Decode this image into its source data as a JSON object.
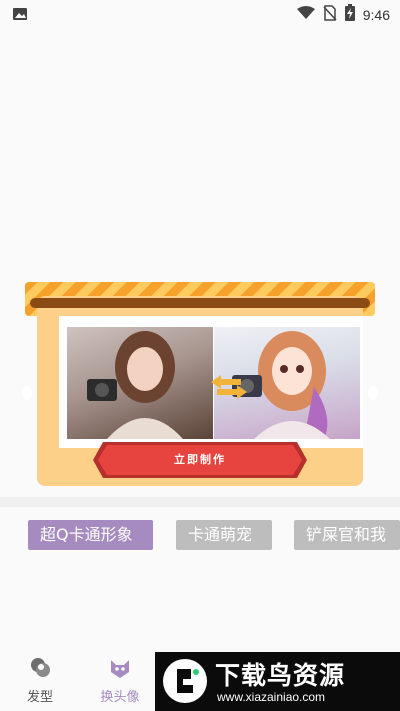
{
  "status_bar": {
    "time": "9:46",
    "icons": [
      "image-icon",
      "wifi-icon",
      "no-sim-icon",
      "battery-charging-icon"
    ]
  },
  "banner": {
    "cta_label": "立即制作",
    "swap_icon": "swap-arrows-icon",
    "left_photo": "real-photo-girl-with-camera",
    "right_photo": "cartoon-girl-with-camera"
  },
  "categories": [
    {
      "label": "超Q卡通形象",
      "active": true
    },
    {
      "label": "卡通萌宠",
      "active": false
    },
    {
      "label": "铲屎官和我",
      "active": false
    }
  ],
  "bottom_nav": [
    {
      "label": "发型",
      "icon": "hairstyle-icon",
      "active": false
    },
    {
      "label": "换头像",
      "icon": "cat-face-icon",
      "active": true
    }
  ],
  "watermark": {
    "title": "下载鸟资源",
    "url": "www.xiazainiao.com"
  },
  "colors": {
    "accent": "#a58bc0",
    "inactive_tab": "#bdbdbd",
    "cta": "#e8443f",
    "awning_dark": "#f6a12b",
    "awning_light": "#ffca5e",
    "card": "#fcd089"
  }
}
